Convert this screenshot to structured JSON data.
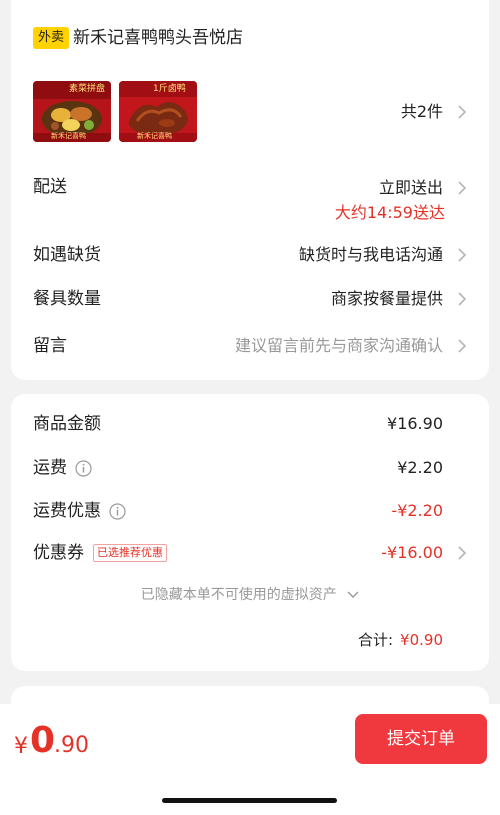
{
  "store": {
    "tag": "外卖",
    "name": "新禾记喜鸭鸭头吾悦店"
  },
  "products": {
    "count_label": "共2件",
    "thumb1_text": "素菜拼盘",
    "thumb1_brand": "新禾记喜鸭",
    "thumb2_text": "1斤卤鸭",
    "thumb2_brand": "新禾记喜鸭"
  },
  "delivery": {
    "label": "配送",
    "value": "立即送出",
    "eta": "大约14:59送达"
  },
  "shortage": {
    "label": "如遇缺货",
    "value": "缺货时与我电话沟通"
  },
  "tableware": {
    "label": "餐具数量",
    "value": "商家按餐量提供"
  },
  "remark": {
    "label": "留言",
    "placeholder": "建议留言前先与商家沟通确认"
  },
  "pricing": {
    "goods_label": "商品金额",
    "goods_value": "¥16.90",
    "shipping_label": "运费",
    "shipping_value": "¥2.20",
    "shipping_discount_label": "运费优惠",
    "shipping_discount_value": "-¥2.20",
    "coupon_label": "优惠券",
    "coupon_badge": "已选推荐优惠",
    "coupon_value": "-¥16.00",
    "hidden_assets": "已隐藏本单不可使用的虚拟资产",
    "total_label": "合计:",
    "total_value": "¥0.90"
  },
  "footer": {
    "pay_symbol": "¥",
    "pay_int": "0",
    "pay_dec": ".90",
    "submit_label": "提交订单"
  },
  "colors": {
    "accent_red": "#e53228",
    "button_red": "#f0393e",
    "tag_yellow": "#ffd200"
  }
}
